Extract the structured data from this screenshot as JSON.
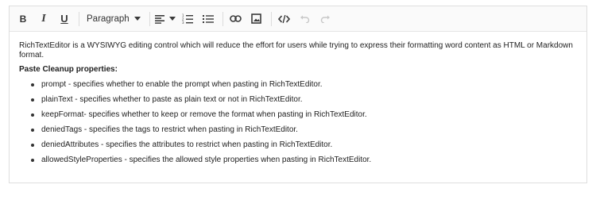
{
  "toolbar": {
    "bold_label": "B",
    "italic_label": "I",
    "underline_label": "U",
    "format_dropdown": "Paragraph",
    "icons": [
      "bold-icon",
      "italic-icon",
      "underline-icon",
      "format-dropdown",
      "align-icon",
      "ordered-list-icon",
      "unordered-list-icon",
      "link-icon",
      "image-icon",
      "source-code-icon",
      "undo-icon",
      "redo-icon"
    ]
  },
  "content": {
    "intro": "RichTextEditor is a WYSIWYG editing control which will reduce the effort for users while trying to express their formatting word content as HTML or Markdown format.",
    "heading": "Paste Cleanup properties:",
    "items": [
      "prompt - specifies whether to enable the prompt when pasting in RichTextEditor.",
      "plainText - specifies whether to paste as plain text or not in RichTextEditor.",
      "keepFormat- specifies whether to keep or remove the format when pasting in RichTextEditor.",
      "deniedTags - specifies the tags to restrict when pasting in RichTextEditor.",
      "deniedAttributes - specifies the attributes to restrict when pasting in RichTextEditor.",
      "allowedStyleProperties - specifies the allowed style properties when pasting in RichTextEditor."
    ]
  }
}
